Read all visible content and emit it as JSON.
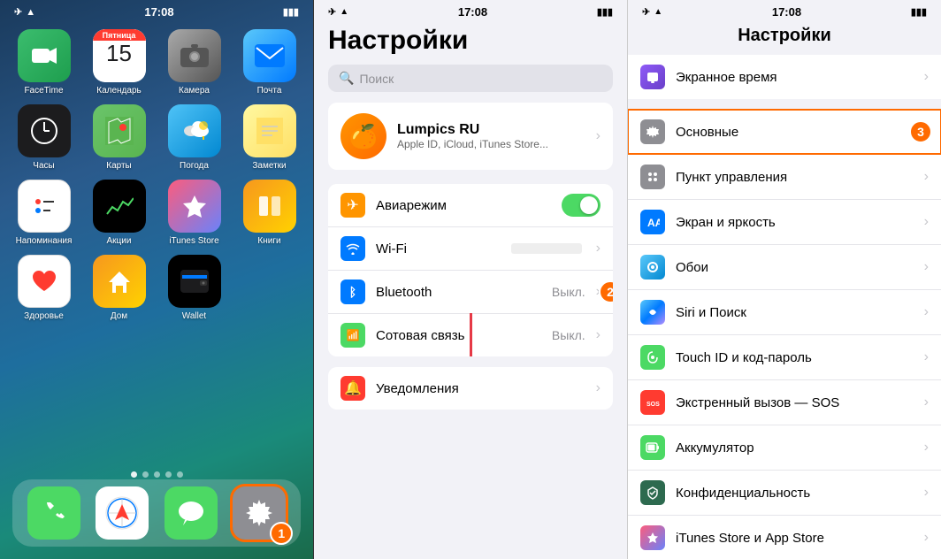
{
  "panel1": {
    "status": {
      "time": "17:08",
      "signal": "✈",
      "wifi": "wifi",
      "battery": "🔋"
    },
    "apps": [
      {
        "id": "facetime",
        "label": "FaceTime",
        "icon": "📹",
        "color": "ic-facetime"
      },
      {
        "id": "calendar",
        "label": "Календарь",
        "icon": "calendar",
        "color": "ic-calendar"
      },
      {
        "id": "camera",
        "label": "Камера",
        "icon": "📷",
        "color": "ic-camera"
      },
      {
        "id": "mail",
        "label": "Почта",
        "icon": "✉️",
        "color": "ic-mail"
      },
      {
        "id": "clock",
        "label": "Часы",
        "icon": "🕐",
        "color": "ic-clock"
      },
      {
        "id": "maps",
        "label": "Карты",
        "icon": "🗺️",
        "color": "ic-maps"
      },
      {
        "id": "weather",
        "label": "Погода",
        "icon": "🌤️",
        "color": "ic-weather"
      },
      {
        "id": "notes",
        "label": "Заметки",
        "icon": "📝",
        "color": "ic-notes"
      },
      {
        "id": "reminders",
        "label": "Напоминания",
        "icon": "🔔",
        "color": "ic-reminders"
      },
      {
        "id": "stocks",
        "label": "Акции",
        "icon": "📈",
        "color": "ic-stocks"
      },
      {
        "id": "itunesstore",
        "label": "iTunes Store",
        "icon": "⭐",
        "color": "ic-itunesstore"
      },
      {
        "id": "books",
        "label": "Книги",
        "icon": "📚",
        "color": "ic-books"
      },
      {
        "id": "health",
        "label": "Здоровье",
        "icon": "❤️",
        "color": "ic-health"
      },
      {
        "id": "home",
        "label": "Дом",
        "icon": "🏠",
        "color": "ic-home"
      },
      {
        "id": "wallet",
        "label": "Wallet",
        "icon": "💳",
        "color": "ic-wallet"
      }
    ],
    "dock": [
      {
        "id": "phone",
        "label": "Телефон",
        "icon": "📞",
        "color": "#4cd964"
      },
      {
        "id": "safari",
        "label": "Safari",
        "icon": "🧭",
        "color": "#007aff"
      },
      {
        "id": "messages",
        "label": "Сообщения",
        "icon": "💬",
        "color": "#4cd964"
      },
      {
        "id": "settings",
        "label": "Настройки",
        "icon": "⚙️",
        "color": "#8e8e93"
      }
    ],
    "calendar_day": "15",
    "calendar_weekday": "Пятница"
  },
  "panel2": {
    "status": {
      "time": "17:08"
    },
    "title": "Настройки",
    "search_placeholder": "Поиск",
    "profile": {
      "name": "Lumpics RU",
      "subtitle": "Apple ID, iCloud, iTunes Store..."
    },
    "rows": [
      {
        "id": "airplane",
        "label": "Авиарежим",
        "value": "",
        "toggle": true
      },
      {
        "id": "wifi",
        "label": "Wi-Fi",
        "value": ""
      },
      {
        "id": "bluetooth",
        "label": "Bluetooth",
        "value": "Выкл."
      },
      {
        "id": "cellular",
        "label": "Сотовая связь",
        "value": "Выкл."
      },
      {
        "id": "notifications",
        "label": "Уведомления",
        "value": ""
      }
    ]
  },
  "panel3": {
    "status": {
      "time": "17:08"
    },
    "title": "Настройки",
    "rows": [
      {
        "id": "screentime",
        "label": "Экранное время",
        "value": ""
      },
      {
        "id": "general",
        "label": "Основные",
        "highlighted": true
      },
      {
        "id": "controlcenter",
        "label": "Пункт управления",
        "value": ""
      },
      {
        "id": "display",
        "label": "Экран и яркость",
        "value": ""
      },
      {
        "id": "wallpaper",
        "label": "Обои",
        "value": ""
      },
      {
        "id": "siri",
        "label": "Siri и Поиск",
        "value": ""
      },
      {
        "id": "touchid",
        "label": "Touch ID и код-пароль",
        "value": ""
      },
      {
        "id": "sos",
        "label": "Экстренный вызов — SOS",
        "value": ""
      },
      {
        "id": "battery",
        "label": "Аккумулятор",
        "value": ""
      },
      {
        "id": "privacy",
        "label": "Конфиденциальность",
        "value": ""
      },
      {
        "id": "itunesappstore",
        "label": "iTunes Store и App Store",
        "value": ""
      }
    ],
    "step3_label": "3"
  }
}
